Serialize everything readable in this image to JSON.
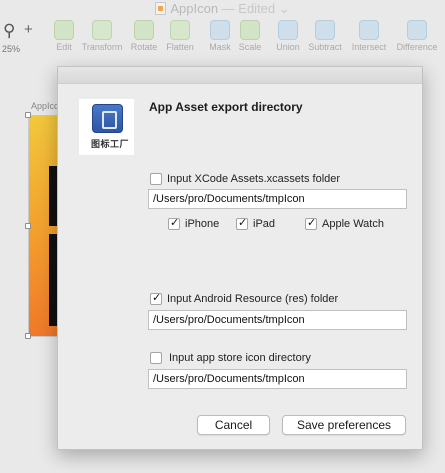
{
  "window": {
    "title": "AppIcon",
    "status": "— Edited ⌄"
  },
  "toolbar": {
    "zoom_level": "25%",
    "tools": [
      {
        "label": "Edit",
        "icon": "edit-icon"
      },
      {
        "label": "Transform",
        "icon": "transform-icon"
      },
      {
        "label": "Rotate",
        "icon": "rotate-icon"
      },
      {
        "label": "Flatten",
        "icon": "flatten-icon"
      },
      {
        "label": "Mask",
        "icon": "mask-icon"
      },
      {
        "label": "Scale",
        "icon": "scale-icon"
      },
      {
        "label": "Union",
        "icon": "union-icon"
      },
      {
        "label": "Subtract",
        "icon": "subtract-icon"
      },
      {
        "label": "Intersect",
        "icon": "intersect-icon"
      },
      {
        "label": "Difference",
        "icon": "difference-icon"
      }
    ]
  },
  "canvas": {
    "artboard_label": "AppIco"
  },
  "dialog": {
    "title": "App Asset export directory",
    "logo_text": "图标工厂",
    "xcode": {
      "label": "Input XCode Assets.xcassets folder",
      "checked": false,
      "path": "/Users/pro/Documents/tmpIcon",
      "devices": [
        {
          "label": "iPhone",
          "checked": true
        },
        {
          "label": "iPad",
          "checked": true
        },
        {
          "label": "Apple Watch",
          "checked": true
        }
      ]
    },
    "android": {
      "label": "Input Android Resource (res) folder",
      "checked": true,
      "path": "/Users/pro/Documents/tmpIcon"
    },
    "appstore": {
      "label": "Input app store icon directory",
      "checked": false,
      "path": "/Users/pro/Documents/tmpIcon"
    },
    "cancel_label": "Cancel",
    "save_label": "Save preferences"
  }
}
